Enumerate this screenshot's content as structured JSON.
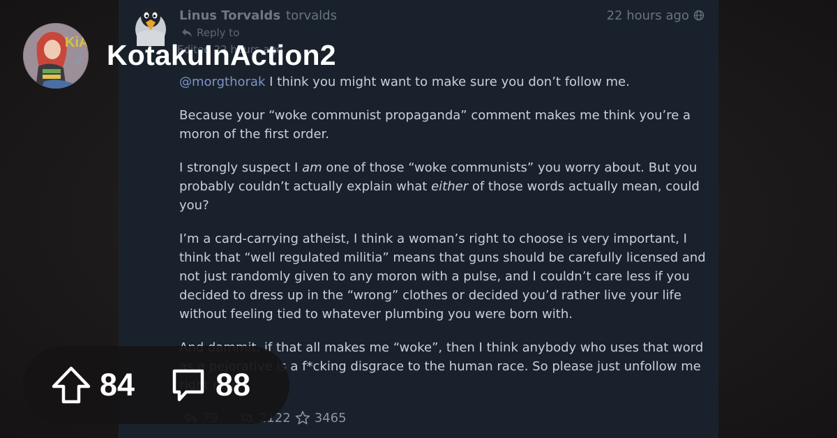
{
  "community": {
    "name": "KotakuInAction2",
    "avatar_text": "KiA",
    "avatar_number": "2"
  },
  "stats": {
    "upvotes": "84",
    "comments": "88"
  },
  "post": {
    "author_name": "Linus Torvalds",
    "author_handle": "torvalds",
    "time": "22 hours ago",
    "reply_to": "Reply to",
    "edited": "Edited 22 hours ago",
    "mention": "@morgthorak",
    "p1_rest": " I think you might want to make sure you don’t follow me.",
    "p2": "Because your “woke communist propaganda” comment makes me think you’re a moron of the first order.",
    "p3_a": "I strongly suspect I ",
    "p3_em1": "am",
    "p3_b": " one of those “woke communists” you worry about. But you probably couldn’t actually explain what ",
    "p3_em2": "either",
    "p3_c": " of those words actually mean, could you?",
    "p4": "I’m a card-carrying atheist, I think a woman’s right to choose is very important, I think that “well regulated militia” means that guns should be carefully licensed and not just randomly given to any moron with a pulse, and I couldn’t care less if you decided to dress up in the “wrong” clothes or decided you’d rather live your life without feeling tied to whatever plumbing you were born with.",
    "p5": "And dammit, if that all makes me “woke”, then I think anybody who uses that word as a pejorative is a f*cking disgrace to the human race. So please just unfollow me right now.",
    "replies": "79",
    "boosts": "2122",
    "favorites": "3465"
  },
  "colors": {
    "background": "#1a1718",
    "post_background": "#19222c",
    "mention": "#7f93c8",
    "pill_background": "#161314",
    "text_white": "#ffffff"
  },
  "icons": [
    "upvote-arrow-icon",
    "comment-bubble-icon",
    "reply-icon",
    "boost-icon",
    "star-icon",
    "globe-icon",
    "penguin-avatar"
  ]
}
